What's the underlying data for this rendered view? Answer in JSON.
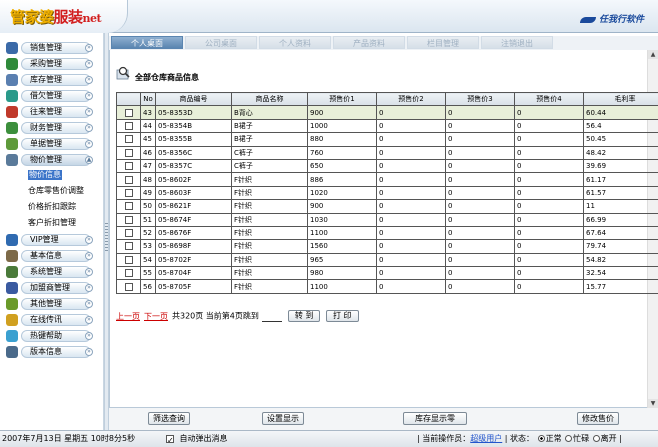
{
  "header": {
    "logo_part1": "管家婆",
    "logo_part2": "服装",
    "logo_part3": "net",
    "brand": "任我行软件"
  },
  "sidebar": {
    "items": [
      {
        "label": "销售管理",
        "icon_color": "#3b6aa8"
      },
      {
        "label": "采购管理",
        "icon_color": "#2f8a3a"
      },
      {
        "label": "库存管理",
        "icon_color": "#5a7fb0"
      },
      {
        "label": "借欠管理",
        "icon_color": "#2a9a8a"
      },
      {
        "label": "往来管理",
        "icon_color": "#c0392b"
      },
      {
        "label": "财务管理",
        "icon_color": "#3c8f3c"
      },
      {
        "label": "单据管理",
        "icon_color": "#5e9a3a"
      },
      {
        "label": "物价管理",
        "icon_color": "#5a7a9a"
      },
      {
        "label": "VIP管理",
        "icon_color": "#2f6ab0"
      },
      {
        "label": "基本信息",
        "icon_color": "#7d6a48"
      },
      {
        "label": "系统管理",
        "icon_color": "#4a7a3a"
      },
      {
        "label": "加盟商管理",
        "icon_color": "#3a5aa0"
      },
      {
        "label": "其他管理",
        "icon_color": "#6a9a2a"
      },
      {
        "label": "在线传讯",
        "icon_color": "#d0a020"
      },
      {
        "label": "热键帮助",
        "icon_color": "#3aa0d0"
      },
      {
        "label": "版本信息",
        "icon_color": "#4a6a8a"
      }
    ],
    "submenu": [
      "物价信息",
      "仓库零售价调整",
      "价格折扣跟踪",
      "客户折扣管理"
    ]
  },
  "tabs": [
    "个人桌面",
    "公司桌面",
    "个人资料",
    "产品资料",
    "栏目管理",
    "注销退出"
  ],
  "page": {
    "heading": "全部仓库商品信息"
  },
  "table": {
    "headers": [
      "",
      "No",
      "商品编号",
      "商品名称",
      "预售价1",
      "预售价2",
      "预售价3",
      "预售价4",
      "毛利率"
    ],
    "rows": [
      [
        "43",
        "05-8353D",
        "B背心",
        "900",
        "0",
        "0",
        "0",
        "60.44"
      ],
      [
        "44",
        "05-8354B",
        "B裙子",
        "1000",
        "0",
        "0",
        "0",
        "56.4"
      ],
      [
        "45",
        "05-8355B",
        "B裙子",
        "880",
        "0",
        "0",
        "0",
        "50.45"
      ],
      [
        "46",
        "05-8356C",
        "C裤子",
        "760",
        "0",
        "0",
        "0",
        "48.42"
      ],
      [
        "47",
        "05-8357C",
        "C裤子",
        "650",
        "0",
        "0",
        "0",
        "39.69"
      ],
      [
        "48",
        "05-8602F",
        "F针织",
        "886",
        "0",
        "0",
        "0",
        "61.17"
      ],
      [
        "49",
        "05-8603F",
        "F针织",
        "1020",
        "0",
        "0",
        "0",
        "61.57"
      ],
      [
        "50",
        "05-8621F",
        "F针织",
        "900",
        "0",
        "0",
        "0",
        "11"
      ],
      [
        "51",
        "05-8674F",
        "F针织",
        "1030",
        "0",
        "0",
        "0",
        "66.99"
      ],
      [
        "52",
        "05-8676F",
        "F针织",
        "1100",
        "0",
        "0",
        "0",
        "67.64"
      ],
      [
        "53",
        "05-8698F",
        "F针织",
        "1560",
        "0",
        "0",
        "0",
        "79.74"
      ],
      [
        "54",
        "05-8702F",
        "F针织",
        "965",
        "0",
        "0",
        "0",
        "54.82"
      ],
      [
        "55",
        "05-8704F",
        "F针织",
        "980",
        "0",
        "0",
        "0",
        "32.54"
      ],
      [
        "56",
        "05-8705F",
        "F针织",
        "1100",
        "0",
        "0",
        "0",
        "15.77"
      ]
    ]
  },
  "pager": {
    "prev": "上一页",
    "next": "下一页",
    "info": "共320页 当前第4页跳到",
    "go": "转 到",
    "print": "打 印"
  },
  "buttons": {
    "filter": "筛选查询",
    "display": "设置显示",
    "stock_retail": "库存显示零",
    "modify_price": "修改售价"
  },
  "status": {
    "datetime": "2007年7月13日 星期五 10时8分5秒",
    "auto_popup": "自动弹出消息",
    "operator_label": "当前操作员：",
    "operator": "超级用户",
    "state_label": "状态：",
    "state_normal": "正常",
    "state_busy": "忙碌",
    "state_away": "离开"
  }
}
